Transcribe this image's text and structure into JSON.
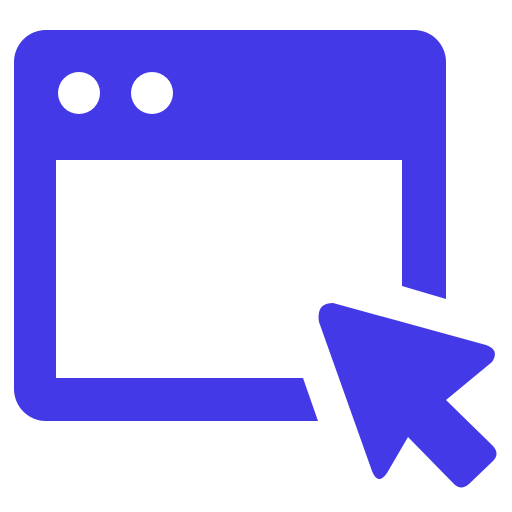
{
  "icon": {
    "name": "browser-window-click-icon",
    "parts": [
      "window-icon",
      "mouse-pointer-icon"
    ]
  },
  "colors": {
    "accent": "#4439E6",
    "background": "#FFFFFF"
  }
}
